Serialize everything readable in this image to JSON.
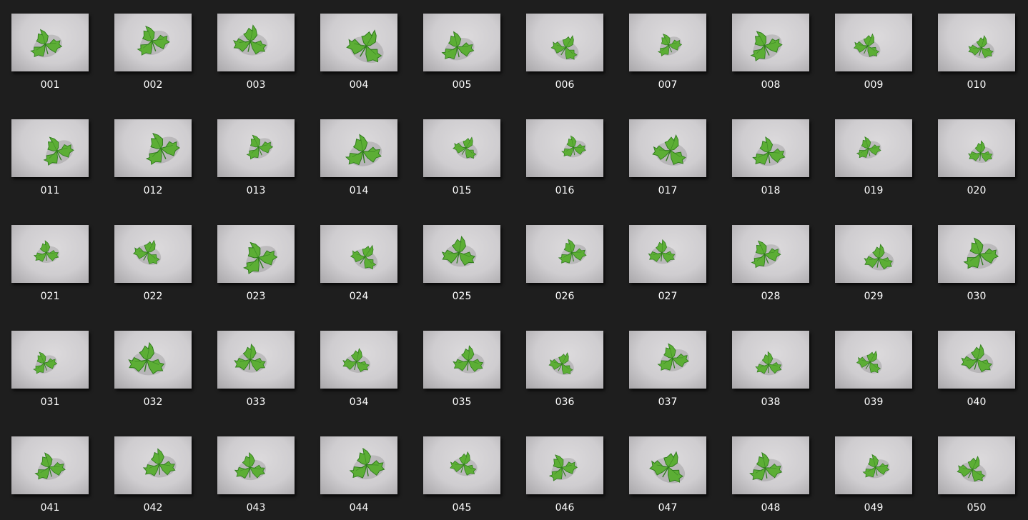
{
  "thumbnail_icon": "leaf-photo-icon",
  "colors": {
    "background": "#1e1e1e",
    "label": "#ffffff",
    "leaf_dark": "#2f7a1d",
    "leaf_light": "#5cae35",
    "paper": "#d6d4d6"
  },
  "files": [
    {
      "label": "001"
    },
    {
      "label": "002"
    },
    {
      "label": "003"
    },
    {
      "label": "004"
    },
    {
      "label": "005"
    },
    {
      "label": "006"
    },
    {
      "label": "007"
    },
    {
      "label": "008"
    },
    {
      "label": "009"
    },
    {
      "label": "010"
    },
    {
      "label": "011"
    },
    {
      "label": "012"
    },
    {
      "label": "013"
    },
    {
      "label": "014"
    },
    {
      "label": "015"
    },
    {
      "label": "016"
    },
    {
      "label": "017"
    },
    {
      "label": "018"
    },
    {
      "label": "019"
    },
    {
      "label": "020"
    },
    {
      "label": "021"
    },
    {
      "label": "022"
    },
    {
      "label": "023"
    },
    {
      "label": "024"
    },
    {
      "label": "025"
    },
    {
      "label": "026"
    },
    {
      "label": "027"
    },
    {
      "label": "028"
    },
    {
      "label": "029"
    },
    {
      "label": "030"
    },
    {
      "label": "031"
    },
    {
      "label": "032"
    },
    {
      "label": "033"
    },
    {
      "label": "034"
    },
    {
      "label": "035"
    },
    {
      "label": "036"
    },
    {
      "label": "037"
    },
    {
      "label": "038"
    },
    {
      "label": "039"
    },
    {
      "label": "040"
    },
    {
      "label": "041"
    },
    {
      "label": "042"
    },
    {
      "label": "043"
    },
    {
      "label": "044"
    },
    {
      "label": "045"
    },
    {
      "label": "046"
    },
    {
      "label": "047"
    },
    {
      "label": "048"
    },
    {
      "label": "049"
    },
    {
      "label": "050"
    }
  ]
}
